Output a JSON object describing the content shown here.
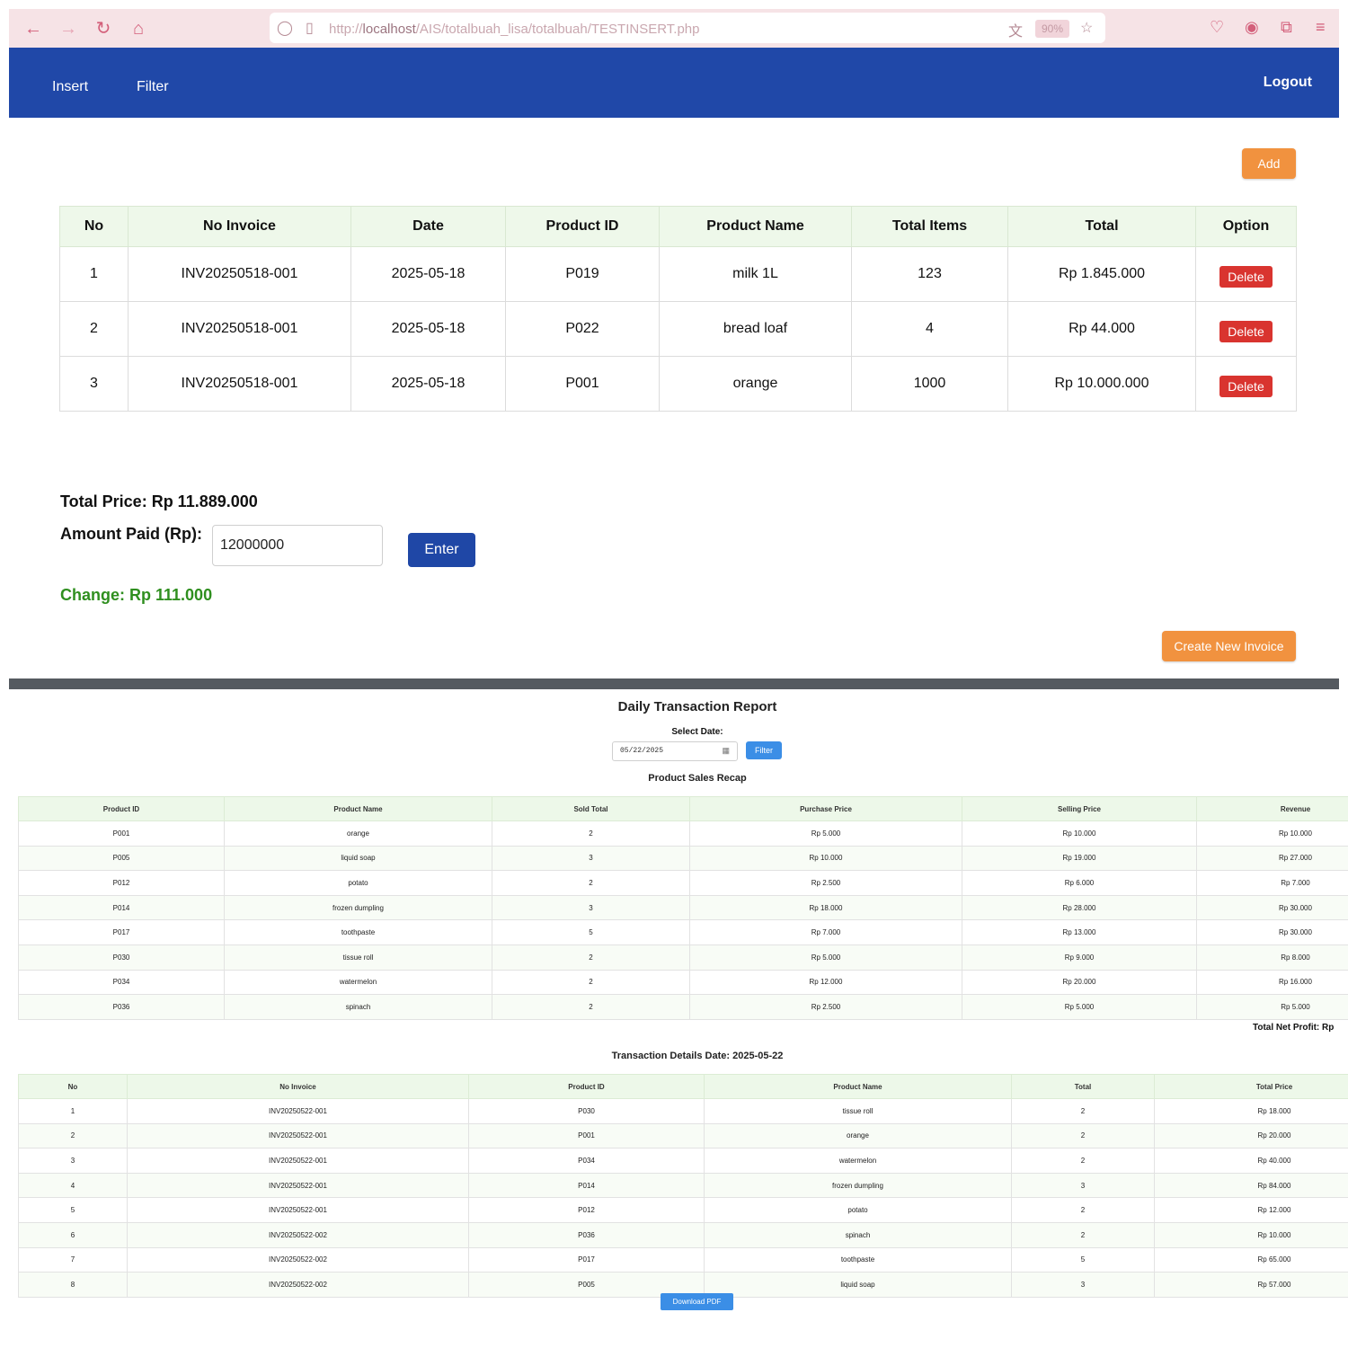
{
  "browser": {
    "url_prefix": "http://",
    "url_host": "localhost",
    "url_path": "/AIS/totalbuah_lisa/totalbuah/TESTINSERT.php",
    "zoom": "90%"
  },
  "nav": {
    "insert": "Insert",
    "filter": "Filter",
    "logout": "Logout"
  },
  "buttons": {
    "add": "Add",
    "enter": "Enter",
    "create_invoice": "Create New Invoice",
    "delete": "Delete",
    "filter": "Filter",
    "download_pdf": "Download PDF"
  },
  "main_table": {
    "headers": [
      "No",
      "No Invoice",
      "Date",
      "Product ID",
      "Product Name",
      "Total Items",
      "Total",
      "Option"
    ],
    "rows": [
      [
        "1",
        "INV20250518-001",
        "2025-05-18",
        "P019",
        "milk 1L",
        "123",
        "Rp 1.845.000"
      ],
      [
        "2",
        "INV20250518-001",
        "2025-05-18",
        "P022",
        "bread loaf",
        "4",
        "Rp 44.000"
      ],
      [
        "3",
        "INV20250518-001",
        "2025-05-18",
        "P001",
        "orange",
        "1000",
        "Rp 10.000.000"
      ]
    ]
  },
  "payment": {
    "total_price": "Total Price: Rp 11.889.000",
    "amount_label": "Amount Paid (Rp):",
    "amount_value": "12000000",
    "change": "Change: Rp 111.000"
  },
  "report": {
    "title": "Daily Transaction Report",
    "select_label": "Select Date:",
    "date_value": "05/22/2025",
    "recap_title": "Product Sales Recap",
    "recap_headers": [
      "Product ID",
      "Product Name",
      "Sold Total",
      "Purchase Price",
      "Selling Price",
      "Revenue"
    ],
    "recap_rows": [
      [
        "P001",
        "orange",
        "2",
        "Rp 5.000",
        "Rp 10.000",
        "Rp 10.000"
      ],
      [
        "P005",
        "liquid soap",
        "3",
        "Rp 10.000",
        "Rp 19.000",
        "Rp 27.000"
      ],
      [
        "P012",
        "potato",
        "2",
        "Rp 2.500",
        "Rp 6.000",
        "Rp 7.000"
      ],
      [
        "P014",
        "frozen dumpling",
        "3",
        "Rp 18.000",
        "Rp 28.000",
        "Rp 30.000"
      ],
      [
        "P017",
        "toothpaste",
        "5",
        "Rp 7.000",
        "Rp 13.000",
        "Rp 30.000"
      ],
      [
        "P030",
        "tissue roll",
        "2",
        "Rp 5.000",
        "Rp 9.000",
        "Rp 8.000"
      ],
      [
        "P034",
        "watermelon",
        "2",
        "Rp 12.000",
        "Rp 20.000",
        "Rp 16.000"
      ],
      [
        "P036",
        "spinach",
        "2",
        "Rp 2.500",
        "Rp 5.000",
        "Rp 5.000"
      ]
    ],
    "net_profit": "Total Net Profit: Rp",
    "details_title": "Transaction Details Date: 2025-05-22",
    "details_headers": [
      "No",
      "No Invoice",
      "Product ID",
      "Product Name",
      "Total",
      "Total Price"
    ],
    "details_rows": [
      [
        "1",
        "INV20250522-001",
        "P030",
        "tissue roll",
        "2",
        "Rp 18.000"
      ],
      [
        "2",
        "INV20250522-001",
        "P001",
        "orange",
        "2",
        "Rp 20.000"
      ],
      [
        "3",
        "INV20250522-001",
        "P034",
        "watermelon",
        "2",
        "Rp 40.000"
      ],
      [
        "4",
        "INV20250522-001",
        "P014",
        "frozen dumpling",
        "3",
        "Rp 84.000"
      ],
      [
        "5",
        "INV20250522-001",
        "P012",
        "potato",
        "2",
        "Rp 12.000"
      ],
      [
        "6",
        "INV20250522-002",
        "P036",
        "spinach",
        "2",
        "Rp 10.000"
      ],
      [
        "7",
        "INV20250522-002",
        "P017",
        "toothpaste",
        "5",
        "Rp 65.000"
      ],
      [
        "8",
        "INV20250522-002",
        "P005",
        "liquid soap",
        "3",
        "Rp 57.000"
      ]
    ]
  },
  "colors": {
    "nav": "#2048a8",
    "orange": "#f1923f",
    "delete": "#d9342f",
    "change": "#2f8f1f",
    "filter": "#3b8ee6"
  }
}
